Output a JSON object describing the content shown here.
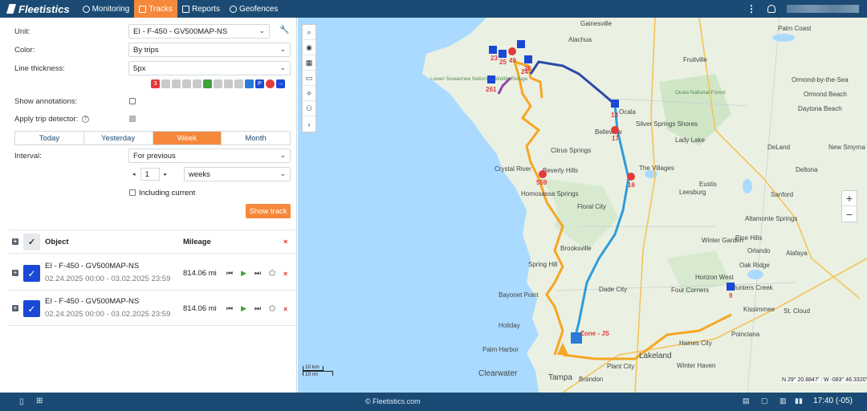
{
  "app": {
    "logo_text": "Fleetistics"
  },
  "nav": [
    {
      "label": "Monitoring",
      "active": false
    },
    {
      "label": "Tracks",
      "active": true
    },
    {
      "label": "Reports",
      "active": false
    },
    {
      "label": "Geofences",
      "active": false
    }
  ],
  "panel": {
    "unit_label": "Unit:",
    "unit_value": "EI - F-450 - GV500MAP-NS",
    "color_label": "Color:",
    "color_value": "By trips",
    "thickness_label": "Line thickness:",
    "thickness_value": "5px",
    "annotations_label": "Show annotations:",
    "trip_detector_label": "Apply trip detector:",
    "tabs": [
      "Today",
      "Yesterday",
      "Week",
      "Month"
    ],
    "active_tab": "Week",
    "interval_label": "Interval:",
    "interval_value": "For previous",
    "interval_count": "1",
    "interval_unit": "weeks",
    "including_current": "Including current",
    "show_track": "Show track"
  },
  "table": {
    "col_object": "Object",
    "col_mileage": "Mileage",
    "rows": [
      {
        "name": "EI - F-450 - GV500MAP-NS",
        "dates": "02.24.2025 00:00 - 03.02.2025 23:59",
        "mileage": "814.06 mi"
      },
      {
        "name": "EI - F-450 - GV500MAP-NS",
        "dates": "02.24.2025 00:00 - 03.02.2025 23:59",
        "mileage": "814.06 mi"
      }
    ]
  },
  "map": {
    "cities": [
      "Palm Coast",
      "Ormond-by-the-Sea",
      "Ormond Beach",
      "Daytona Beach",
      "DeLand",
      "New Smyrna B",
      "Deltona",
      "Sanford",
      "Altamonte Springs",
      "Pine Hills",
      "Winter Garden",
      "Orlando",
      "Oak Ridge",
      "Alafaya",
      "Horizon West",
      "Hunters Creek",
      "Four Corners",
      "Kissimmee",
      "St. Cloud",
      "Poinciana",
      "Haines City",
      "Lakeland",
      "Winter Haven",
      "Brandon",
      "Tampa",
      "Clearwater",
      "Plant City",
      "Palm Harbor",
      "Holiday",
      "Bayonet Point",
      "Spring Hill",
      "Brooksville",
      "Dade City",
      "Floral City",
      "Homosassa Springs",
      "Beverly Hills",
      "Citrus Springs",
      "Crystal River",
      "Leesburg",
      "The Villages",
      "Eustis",
      "Silver Springs Shores",
      "Ocala",
      "Belleview",
      "Fruitville",
      "Lady Lake",
      "Alachua",
      "Gainesville"
    ],
    "labels_small": [
      "Lower Suwannee National Wildlife Refuge",
      "Ocala National Forest"
    ],
    "scale_km": "10 km",
    "scale_mi": "10 mi",
    "coords": "N 29° 20.8847' : W -083° 46.3320'",
    "markers": [
      "23",
      "25",
      "49",
      "26",
      "24",
      "261",
      "13",
      "17",
      "16",
      "559",
      "9"
    ],
    "zone_label": "Zone - JS"
  },
  "footer": {
    "copyright": "© Fleetistics.com",
    "time": "17:40 (-05)"
  },
  "colors": {
    "primary": "#1b4b74",
    "accent": "#f6883b",
    "checkbox": "#1a49d6"
  }
}
